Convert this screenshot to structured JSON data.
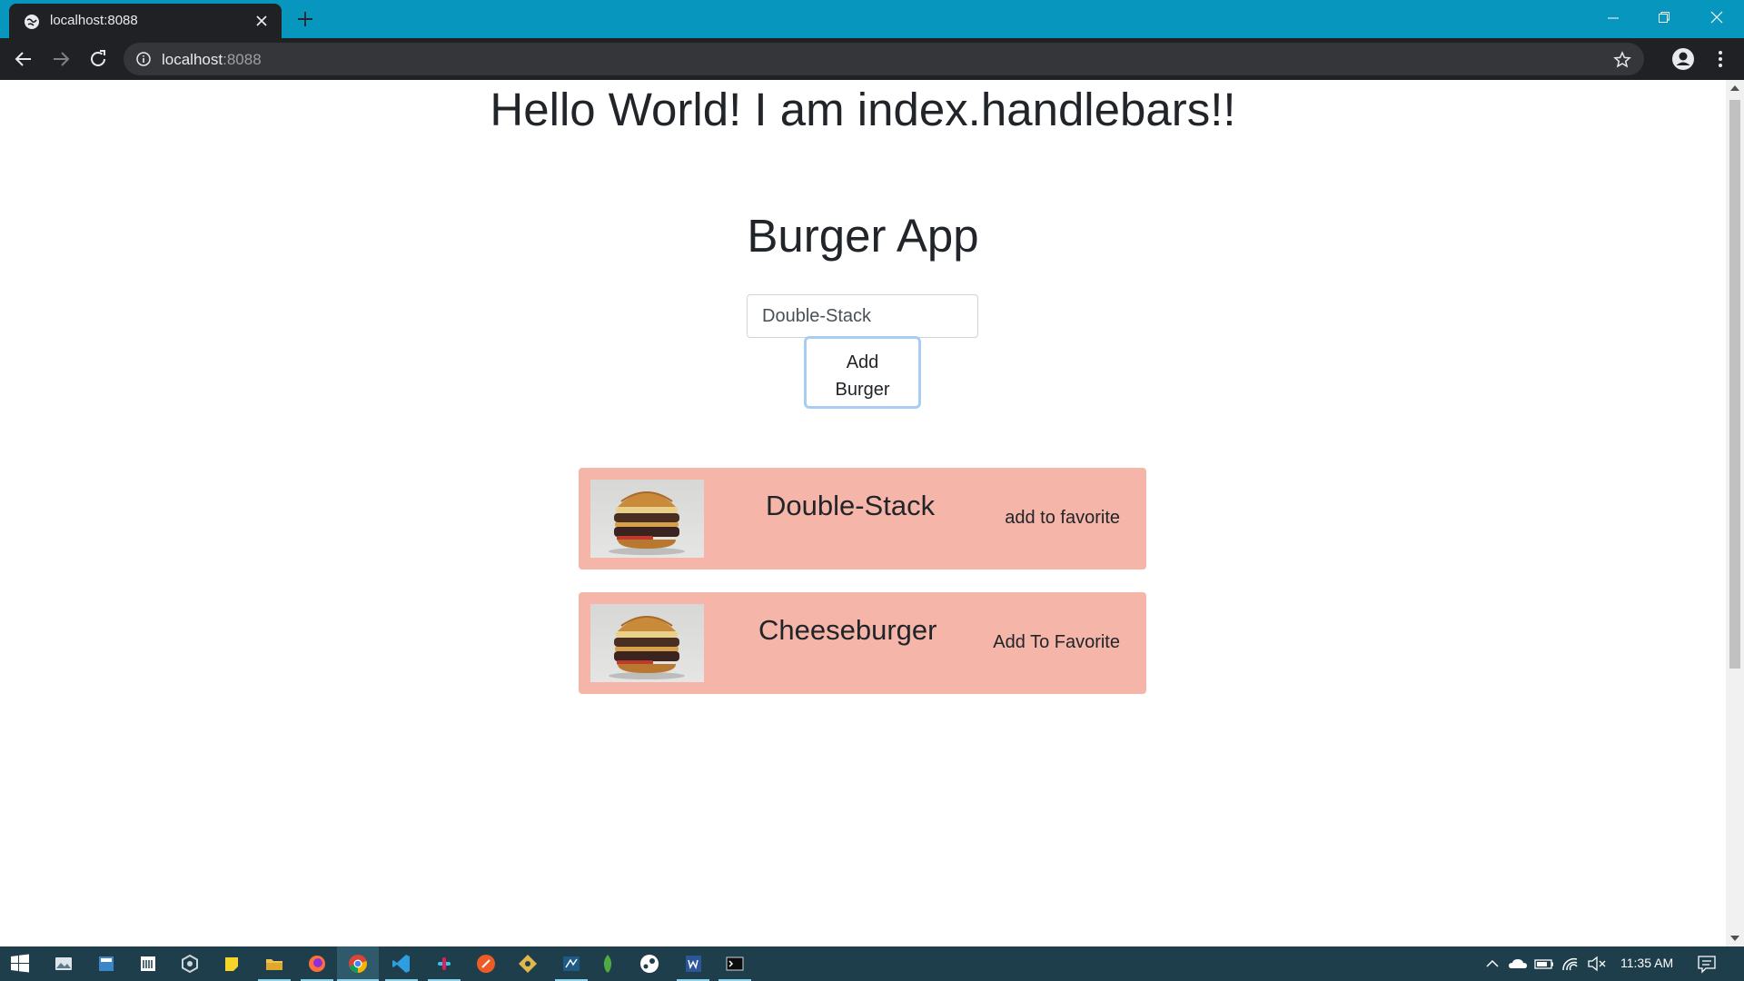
{
  "browser": {
    "tab_title": "localhost:8088",
    "url_host": "localhost",
    "url_port": ":8088"
  },
  "page": {
    "hello_heading": "Hello World! I am index.handlebars!!",
    "app_title": "Burger App",
    "input_value": "Double-Stack",
    "add_button_line1": "Add",
    "add_button_line2": "Burger",
    "burgers": [
      {
        "name": "Double-Stack",
        "action": "add to favorite"
      },
      {
        "name": "Cheeseburger",
        "action": "Add To Favorite"
      }
    ]
  },
  "taskbar": {
    "time": "11:35 AM",
    "pinned_icons": [
      "start-icon",
      "media-icon",
      "calculator-icon",
      "news-icon",
      "unity-icon",
      "sticky-notes-icon",
      "file-explorer-icon",
      "firefox-icon",
      "chrome-icon",
      "vscode-icon",
      "slack-icon",
      "postman-icon",
      "gitkraken-icon",
      "sql-icon",
      "mongodb-icon",
      "steam-icon",
      "word-icon",
      "terminal-icon"
    ]
  },
  "colors": {
    "titlebar": "#0796be",
    "card_bg": "#f5b5a8",
    "taskbar": "#1f3e4c"
  }
}
